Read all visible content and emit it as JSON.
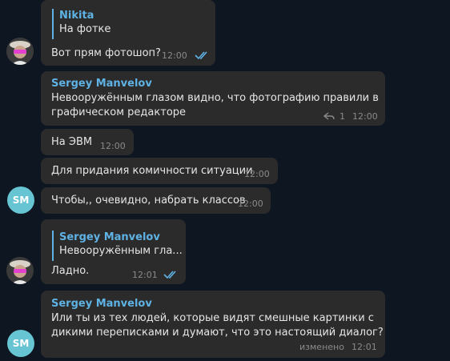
{
  "colors": {
    "background": "#0e1621",
    "bubble": "#2b2b2b",
    "accent": "#5fb2e4",
    "avatar_sm": "#67c4d2",
    "meta": "#8a8a8a"
  },
  "messages": [
    {
      "quote_name": "Nikita",
      "quote_text": "На фотке",
      "text": "Вот прям фотошоп?",
      "time": "12:00",
      "read": true
    },
    {
      "sender": "Sergey Manvelov",
      "text_line1": "Невооружённым глазом видно, что фотографию правили в",
      "text_line2": "графическом редакторе",
      "reply_count": "1",
      "time": "12:00"
    },
    {
      "text": "На ЭВМ",
      "time": "12:00"
    },
    {
      "text": "Для придания комичности ситуации",
      "time": "12:00"
    },
    {
      "text": "Чтобы,, очевидно, набрать классов",
      "time": "12:00"
    },
    {
      "quote_name": "Sergey Manvelov",
      "quote_text": "Невооружённым гла...",
      "text": "Ладно.",
      "time": "12:01",
      "read": true
    },
    {
      "sender": "Sergey Manvelov",
      "text_line1": "Или ты из тех людей, которые видят смешные картинки с",
      "text_line2": "дикими переписками и думают, что это настоящий диалог?",
      "edited": "изменено",
      "time": "12:01"
    }
  ],
  "avatars": {
    "sm_initials": "SM"
  }
}
